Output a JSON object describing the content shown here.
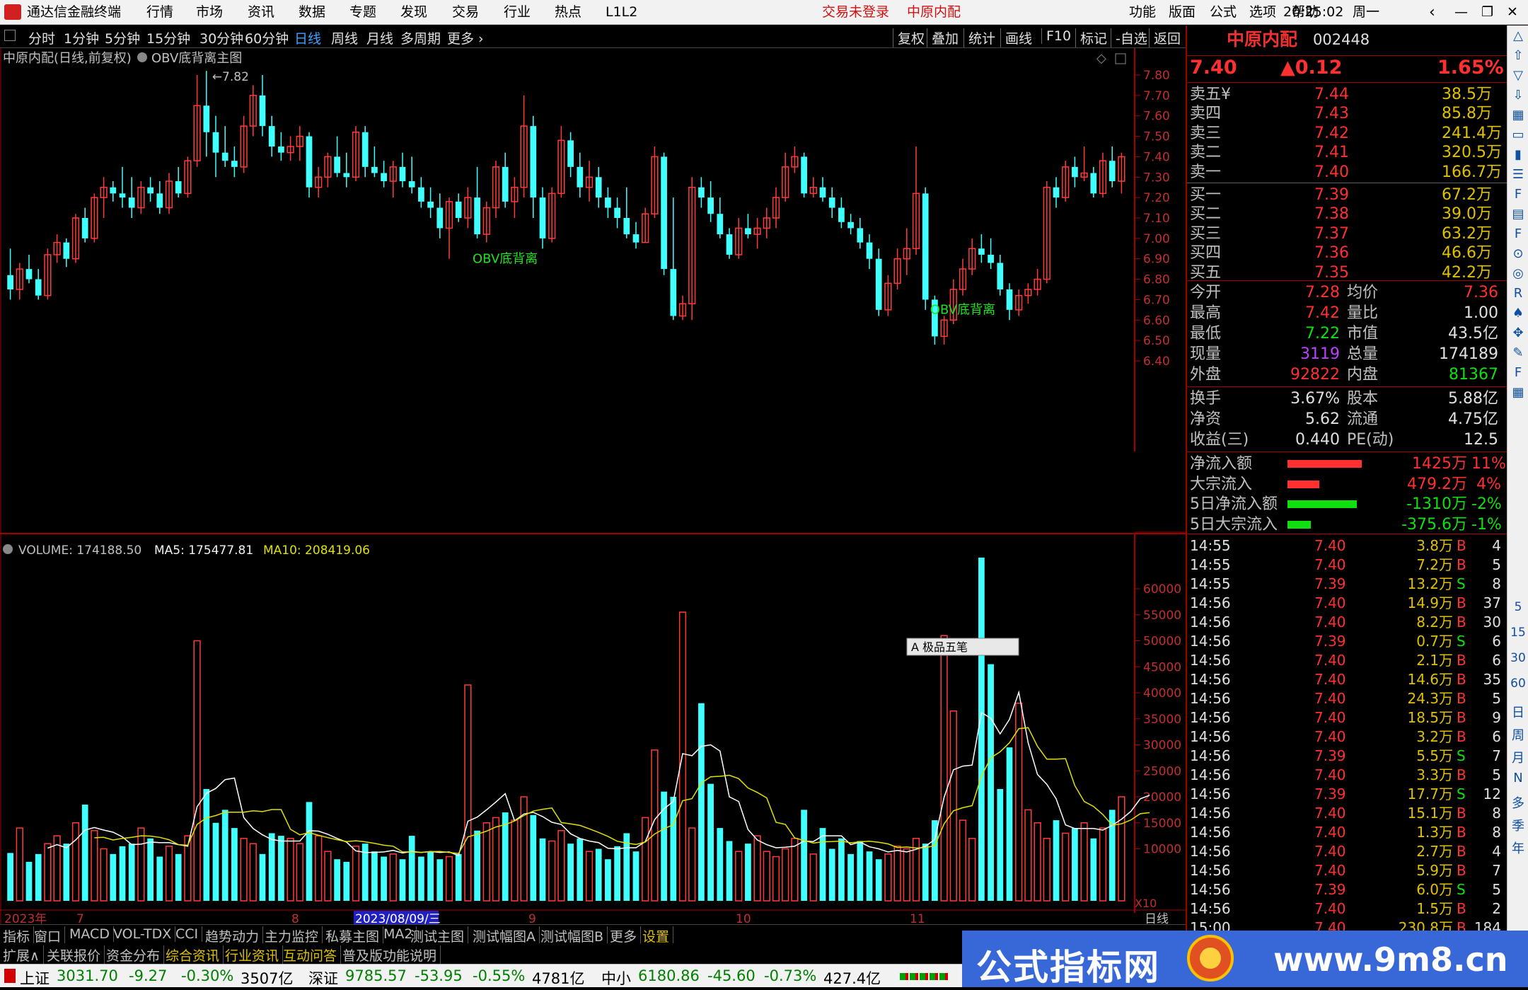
{
  "app": {
    "title": "通达信金融终端",
    "menus": [
      "行情",
      "市场",
      "资讯",
      "数据",
      "专题",
      "发现",
      "交易",
      "行业",
      "热点",
      "L1L2"
    ],
    "login": "交易未登录",
    "stock_title": "中原内配",
    "right_menus": [
      "功能",
      "版面",
      "公式",
      "选项",
      "帮助"
    ],
    "clock": "20:25:02",
    "weekday": "周一"
  },
  "timeframes": [
    "分时",
    "1分钟",
    "5分钟",
    "15分钟",
    "30分钟",
    "60分钟",
    "日线",
    "周线",
    "月线",
    "多周期",
    "更多"
  ],
  "active_tf": "日线",
  "toolbar_right": [
    "复权",
    "叠加",
    "统计",
    "画线",
    "F10",
    "标记",
    "-自选",
    "返回"
  ],
  "chart": {
    "header": "中原内配(日线,前复权)",
    "indicator": "OBV底背离主图",
    "high_mark": "7.82",
    "signals": [
      "OBV底背离",
      "OBV底背离"
    ],
    "y_ticks": [
      "7.80",
      "7.70",
      "7.60",
      "7.50",
      "7.40",
      "7.30",
      "7.20",
      "7.10",
      "7.00",
      "6.90",
      "6.80",
      "6.70",
      "6.60",
      "6.50",
      "6.40"
    ]
  },
  "volume": {
    "label": "VOLUME: 174188.50",
    "ma5": "MA5: 175477.81",
    "ma10": "MA10: 208419.06",
    "y_ticks": [
      "60000",
      "55000",
      "50000",
      "45000",
      "40000",
      "35000",
      "30000",
      "25000",
      "20000",
      "15000",
      "10000"
    ],
    "unit": "X10",
    "ime": "极品五笔"
  },
  "xaxis": {
    "year": "2023年",
    "m7": "7",
    "m8": "8",
    "date": "2023/08/09/三",
    "m9": "9",
    "m10": "10",
    "m11": "11",
    "period": "日线"
  },
  "chart_data": {
    "type": "candlestick",
    "ohlc": [
      [
        6.82,
        6.95,
        6.7,
        6.75
      ],
      [
        6.75,
        6.88,
        6.7,
        6.85
      ],
      [
        6.85,
        6.92,
        6.78,
        6.8
      ],
      [
        6.8,
        6.85,
        6.7,
        6.72
      ],
      [
        6.72,
        6.95,
        6.7,
        6.92
      ],
      [
        6.92,
        7.02,
        6.88,
        6.98
      ],
      [
        6.98,
        7.0,
        6.86,
        6.9
      ],
      [
        6.9,
        7.12,
        6.88,
        7.1
      ],
      [
        7.1,
        7.15,
        6.98,
        7.0
      ],
      [
        7.0,
        7.22,
        6.98,
        7.2
      ],
      [
        7.2,
        7.3,
        7.1,
        7.25
      ],
      [
        7.25,
        7.28,
        7.18,
        7.22
      ],
      [
        7.22,
        7.35,
        7.15,
        7.2
      ],
      [
        7.2,
        7.3,
        7.1,
        7.15
      ],
      [
        7.15,
        7.28,
        7.12,
        7.25
      ],
      [
        7.25,
        7.3,
        7.18,
        7.22
      ],
      [
        7.22,
        7.28,
        7.12,
        7.15
      ],
      [
        7.15,
        7.32,
        7.12,
        7.28
      ],
      [
        7.28,
        7.35,
        7.2,
        7.22
      ],
      [
        7.22,
        7.4,
        7.2,
        7.38
      ],
      [
        7.38,
        7.8,
        7.35,
        7.65
      ],
      [
        7.65,
        7.82,
        7.4,
        7.52
      ],
      [
        7.52,
        7.6,
        7.3,
        7.42
      ],
      [
        7.42,
        7.55,
        7.35,
        7.38
      ],
      [
        7.38,
        7.45,
        7.3,
        7.35
      ],
      [
        7.35,
        7.6,
        7.32,
        7.55
      ],
      [
        7.55,
        7.75,
        7.5,
        7.7
      ],
      [
        7.7,
        7.8,
        7.5,
        7.55
      ],
      [
        7.55,
        7.6,
        7.4,
        7.45
      ],
      [
        7.45,
        7.52,
        7.38,
        7.42
      ],
      [
        7.42,
        7.5,
        7.38,
        7.45
      ],
      [
        7.45,
        7.55,
        7.38,
        7.5
      ],
      [
        7.5,
        7.52,
        7.2,
        7.25
      ],
      [
        7.25,
        7.35,
        7.2,
        7.3
      ],
      [
        7.3,
        7.42,
        7.25,
        7.4
      ],
      [
        7.4,
        7.5,
        7.3,
        7.32
      ],
      [
        7.32,
        7.42,
        7.25,
        7.3
      ],
      [
        7.3,
        7.55,
        7.28,
        7.52
      ],
      [
        7.52,
        7.55,
        7.3,
        7.35
      ],
      [
        7.35,
        7.45,
        7.3,
        7.32
      ],
      [
        7.32,
        7.38,
        7.25,
        7.28
      ],
      [
        7.28,
        7.38,
        7.2,
        7.35
      ],
      [
        7.35,
        7.42,
        7.25,
        7.28
      ],
      [
        7.28,
        7.4,
        7.22,
        7.25
      ],
      [
        7.25,
        7.3,
        7.15,
        7.18
      ],
      [
        7.18,
        7.25,
        7.1,
        7.15
      ],
      [
        7.15,
        7.22,
        7.0,
        7.05
      ],
      [
        7.05,
        7.2,
        6.9,
        7.18
      ],
      [
        7.18,
        7.22,
        7.08,
        7.1
      ],
      [
        7.1,
        7.25,
        7.05,
        7.2
      ],
      [
        7.2,
        7.35,
        7.0,
        7.02
      ],
      [
        7.02,
        7.18,
        6.98,
        7.15
      ],
      [
        7.15,
        7.38,
        7.1,
        7.35
      ],
      [
        7.35,
        7.42,
        7.15,
        7.18
      ],
      [
        7.18,
        7.3,
        7.1,
        7.25
      ],
      [
        7.25,
        7.7,
        7.2,
        7.55
      ],
      [
        7.55,
        7.6,
        7.1,
        7.2
      ],
      [
        7.2,
        7.25,
        6.95,
        7.0
      ],
      [
        7.0,
        7.25,
        6.98,
        7.22
      ],
      [
        7.22,
        7.55,
        7.2,
        7.48
      ],
      [
        7.48,
        7.52,
        7.3,
        7.35
      ],
      [
        7.35,
        7.42,
        7.2,
        7.25
      ],
      [
        7.25,
        7.38,
        7.18,
        7.3
      ],
      [
        7.3,
        7.35,
        7.15,
        7.2
      ],
      [
        7.2,
        7.25,
        7.1,
        7.15
      ],
      [
        7.15,
        7.2,
        7.05,
        7.1
      ],
      [
        7.1,
        7.25,
        7.0,
        7.02
      ],
      [
        7.02,
        7.08,
        6.95,
        6.98
      ],
      [
        6.98,
        7.15,
        6.98,
        7.12
      ],
      [
        7.12,
        7.45,
        7.1,
        7.4
      ],
      [
        7.4,
        7.42,
        6.82,
        6.85
      ],
      [
        6.85,
        7.2,
        6.6,
        6.62
      ],
      [
        6.62,
        6.72,
        6.6,
        6.68
      ],
      [
        6.68,
        7.3,
        6.6,
        7.25
      ],
      [
        7.25,
        7.3,
        7.15,
        7.2
      ],
      [
        7.2,
        7.28,
        7.08,
        7.12
      ],
      [
        7.12,
        7.2,
        7.0,
        7.02
      ],
      [
        7.02,
        7.05,
        6.9,
        6.92
      ],
      [
        6.92,
        7.1,
        6.9,
        7.05
      ],
      [
        7.05,
        7.12,
        7.0,
        7.02
      ],
      [
        7.02,
        7.1,
        6.95,
        7.05
      ],
      [
        7.05,
        7.15,
        7.0,
        7.1
      ],
      [
        7.1,
        7.25,
        7.05,
        7.2
      ],
      [
        7.2,
        7.42,
        7.18,
        7.35
      ],
      [
        7.35,
        7.45,
        7.32,
        7.4
      ],
      [
        7.4,
        7.42,
        7.2,
        7.22
      ],
      [
        7.22,
        7.3,
        7.2,
        7.25
      ],
      [
        7.25,
        7.3,
        7.18,
        7.2
      ],
      [
        7.2,
        7.25,
        7.1,
        7.15
      ],
      [
        7.15,
        7.2,
        7.05,
        7.08
      ],
      [
        7.08,
        7.12,
        7.02,
        7.05
      ],
      [
        7.05,
        7.1,
        6.95,
        6.98
      ],
      [
        6.98,
        7.02,
        6.85,
        6.9
      ],
      [
        6.9,
        6.95,
        6.62,
        6.65
      ],
      [
        6.65,
        6.82,
        6.62,
        6.78
      ],
      [
        6.78,
        6.95,
        6.75,
        6.9
      ],
      [
        6.9,
        7.05,
        6.82,
        6.95
      ],
      [
        6.95,
        7.45,
        6.92,
        7.22
      ],
      [
        7.22,
        7.25,
        6.65,
        6.7
      ],
      [
        6.7,
        6.72,
        6.48,
        6.52
      ],
      [
        6.52,
        6.62,
        6.48,
        6.6
      ],
      [
        6.6,
        6.8,
        6.58,
        6.75
      ],
      [
        6.75,
        6.9,
        6.72,
        6.85
      ],
      [
        6.85,
        7.0,
        6.82,
        6.95
      ],
      [
        6.95,
        7.02,
        6.88,
        6.92
      ],
      [
        6.92,
        7.0,
        6.85,
        6.88
      ],
      [
        6.88,
        6.92,
        6.72,
        6.75
      ],
      [
        6.75,
        6.78,
        6.6,
        6.65
      ],
      [
        6.65,
        6.75,
        6.62,
        6.72
      ],
      [
        6.72,
        6.78,
        6.68,
        6.75
      ],
      [
        6.75,
        6.85,
        6.72,
        6.8
      ],
      [
        6.8,
        7.28,
        6.78,
        7.25
      ],
      [
        7.25,
        7.3,
        7.15,
        7.2
      ],
      [
        7.2,
        7.38,
        7.18,
        7.35
      ],
      [
        7.35,
        7.4,
        7.25,
        7.3
      ],
      [
        7.3,
        7.45,
        7.28,
        7.32
      ],
      [
        7.32,
        7.35,
        7.2,
        7.22
      ],
      [
        7.22,
        7.42,
        7.2,
        7.38
      ],
      [
        7.38,
        7.45,
        7.25,
        7.28
      ],
      [
        7.28,
        7.42,
        7.22,
        7.4
      ]
    ],
    "volume": [
      9200,
      14000,
      7500,
      9000,
      11000,
      12500,
      11000,
      15000,
      18500,
      13500,
      10000,
      9000,
      10500,
      11000,
      14000,
      12000,
      8500,
      10500,
      9000,
      12500,
      50000,
      21500,
      15000,
      17500,
      14000,
      12000,
      11000,
      9000,
      13000,
      12500,
      12000,
      11000,
      19000,
      12500,
      9500,
      8000,
      7500,
      10500,
      11000,
      9500,
      8500,
      9000,
      8000,
      12500,
      8500,
      9500,
      8000,
      8500,
      9000,
      41500,
      13500,
      15000,
      16000,
      17000,
      15500,
      20000,
      16500,
      12000,
      11500,
      13500,
      11000,
      12000,
      9500,
      10000,
      8000,
      10500,
      13000,
      9500,
      16000,
      29000,
      21000,
      20000,
      55500,
      14000,
      38000,
      22500,
      14000,
      11500,
      9500,
      11000,
      12500,
      9500,
      8500,
      10000,
      12000,
      17500,
      9000,
      14000,
      10000,
      12000,
      9000,
      11500,
      9500,
      8000,
      9000,
      10500,
      10000,
      12000,
      11000,
      15500,
      51000,
      36500,
      15500,
      12000,
      66000,
      45500,
      21500,
      29500,
      38000,
      17500,
      15000,
      12000,
      15500,
      13000,
      14000,
      15000,
      12000,
      14000,
      17500,
      20000,
      22500,
      24000,
      17500
    ],
    "price_ticks": [
      7.8,
      7.7,
      7.6,
      7.5,
      7.4,
      7.3,
      7.2,
      7.1,
      7.0,
      6.9,
      6.8,
      6.7,
      6.6,
      6.5,
      6.4
    ],
    "volume_ticks": [
      60000,
      55000,
      50000,
      45000,
      40000,
      35000,
      30000,
      25000,
      20000,
      15000,
      10000
    ],
    "indicators": [
      "MA5",
      "MA10"
    ],
    "up_color": "#ff3b3b",
    "down_color": "#40ffff",
    "ma5_color": "#ffffff",
    "ma10_color": "#e0e000"
  },
  "quote": {
    "name": "中原内配",
    "code": "002448",
    "price": "7.40",
    "change": "▲0.12",
    "pct": "1.65%",
    "asks": [
      {
        "l": "卖五¥",
        "p": "7.44",
        "v": "38.5万"
      },
      {
        "l": "卖四",
        "p": "7.43",
        "v": "85.8万"
      },
      {
        "l": "卖三",
        "p": "7.42",
        "v": "241.4万"
      },
      {
        "l": "卖二",
        "p": "7.41",
        "v": "320.5万"
      },
      {
        "l": "卖一",
        "p": "7.40",
        "v": "166.7万"
      }
    ],
    "bids": [
      {
        "l": "买一",
        "p": "7.39",
        "v": "67.2万"
      },
      {
        "l": "买二",
        "p": "7.38",
        "v": "39.0万"
      },
      {
        "l": "买三",
        "p": "7.37",
        "v": "63.2万"
      },
      {
        "l": "买四",
        "p": "7.36",
        "v": "46.6万"
      },
      {
        "l": "买五",
        "p": "7.35",
        "v": "42.2万"
      }
    ],
    "stats": [
      {
        "a": "今开",
        "av": "7.28",
        "b": "均价",
        "bv": "7.36"
      },
      {
        "a": "最高",
        "av": "7.42",
        "b": "量比",
        "bv": "1.00"
      },
      {
        "a": "最低",
        "av": "7.22",
        "b": "市值",
        "bv": "43.5亿"
      },
      {
        "a": "现量",
        "av": "3119",
        "b": "总量",
        "bv": "174189"
      },
      {
        "a": "外盘",
        "av": "92822",
        "b": "内盘",
        "bv": "81367"
      }
    ],
    "stats2": [
      {
        "a": "换手",
        "av": "3.67%",
        "b": "股本",
        "bv": "5.88亿"
      },
      {
        "a": "净资",
        "av": "5.62",
        "b": "流通",
        "bv": "4.75亿"
      },
      {
        "a": "收益(三)",
        "av": "0.440",
        "b": "PE(动)",
        "bv": "12.5"
      }
    ],
    "flows": [
      {
        "l": "净流入额",
        "v": "1425万",
        "p": "11%",
        "c": "#ff3030",
        "w": 0.7
      },
      {
        "l": "大宗流入",
        "v": "479.2万",
        "p": "4%",
        "c": "#ff3030",
        "w": 0.3
      },
      {
        "l": "5日净流入额",
        "v": "-1310万",
        "p": "-2%",
        "c": "#10e010",
        "w": 0.65
      },
      {
        "l": "5日大宗流入",
        "v": "-375.6万",
        "p": "-1%",
        "c": "#10e010",
        "w": 0.22
      }
    ],
    "ticks": [
      [
        "14:55",
        "7.40",
        "3.8万",
        "B",
        "4"
      ],
      [
        "14:55",
        "7.40",
        "7.2万",
        "B",
        "5"
      ],
      [
        "14:55",
        "7.39",
        "13.2万",
        "S",
        "8"
      ],
      [
        "14:56",
        "7.40",
        "14.9万",
        "B",
        "37"
      ],
      [
        "14:56",
        "7.40",
        "8.2万",
        "B",
        "30"
      ],
      [
        "14:56",
        "7.39",
        "0.7万",
        "S",
        "6"
      ],
      [
        "14:56",
        "7.40",
        "2.1万",
        "B",
        "6"
      ],
      [
        "14:56",
        "7.40",
        "14.6万",
        "B",
        "35"
      ],
      [
        "14:56",
        "7.40",
        "24.3万",
        "B",
        "5"
      ],
      [
        "14:56",
        "7.40",
        "18.5万",
        "B",
        "9"
      ],
      [
        "14:56",
        "7.40",
        "3.2万",
        "B",
        "6"
      ],
      [
        "14:56",
        "7.39",
        "5.5万",
        "S",
        "7"
      ],
      [
        "14:56",
        "7.40",
        "3.3万",
        "B",
        "5"
      ],
      [
        "14:56",
        "7.39",
        "17.7万",
        "S",
        "12"
      ],
      [
        "14:56",
        "7.40",
        "15.1万",
        "B",
        "8"
      ],
      [
        "14:56",
        "7.40",
        "1.3万",
        "B",
        "8"
      ],
      [
        "14:56",
        "7.40",
        "2.7万",
        "B",
        "4"
      ],
      [
        "14:56",
        "7.40",
        "5.9万",
        "B",
        "7"
      ],
      [
        "14:56",
        "7.39",
        "6.0万",
        "S",
        "5"
      ],
      [
        "14:56",
        "7.40",
        "1.5万",
        "B",
        "2"
      ],
      [
        "15:00",
        "7.40",
        "230.8万",
        "B",
        "184"
      ]
    ]
  },
  "sidebar": [
    "日",
    "周",
    "月",
    "N",
    "多",
    "季",
    "年"
  ],
  "sidebar_nums": [
    "5",
    "15",
    "30",
    "60"
  ],
  "tabs": [
    "指标",
    "窗口",
    "MACD",
    "VOL-TDX",
    "CCI",
    "趋势动力",
    "主力监控",
    "私募主图",
    "MA2",
    "测试主图",
    "测试幅图A",
    "测试幅图B",
    "更多",
    "设置"
  ],
  "links": [
    "扩展∧",
    "关联报价",
    "资金分布",
    "综合资讯",
    "行业资讯",
    "互动问答",
    "普及版功能说明"
  ],
  "status": {
    "sh": "上证",
    "sh_v": "3031.70",
    "sh_c": "-9.27",
    "sh_p": "-0.30%",
    "sh_a": "3507亿",
    "sz": "深证",
    "sz_v": "9785.57",
    "sz_c": "-53.95",
    "sz_p": "-0.55%",
    "sz_a": "4781亿",
    "zx": "中小",
    "zx_v": "6180.86",
    "zx_c": "-45.60",
    "zx_p": "-0.73%",
    "zx_a": "427.4亿"
  },
  "ad": {
    "title": "公式指标网",
    "url": "www.9m8.cn"
  }
}
